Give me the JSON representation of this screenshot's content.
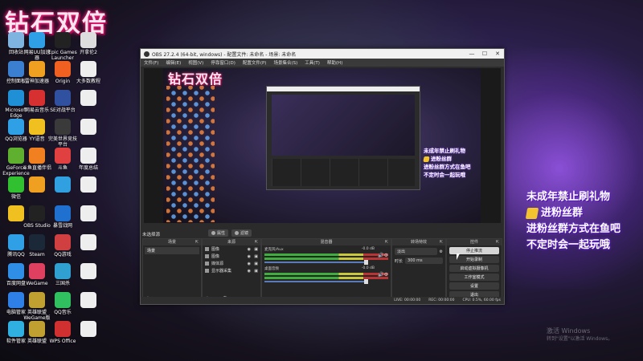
{
  "desktop": {
    "banner": "钻石双倍",
    "icons": [
      {
        "label": "回收站",
        "color": "#7fb3e0"
      },
      {
        "label": "网易UU加速器",
        "color": "#2fa0e6"
      },
      {
        "label": "Epic Games Launcher",
        "color": "#222222"
      },
      {
        "label": "开拿伦2",
        "color": "#dddddd"
      },
      {
        "label": "控制面板",
        "color": "#3a7fd0"
      },
      {
        "label": "雷神加速器",
        "color": "#f0a020"
      },
      {
        "label": "Origin",
        "color": "#f06020"
      },
      {
        "label": "大多数教程",
        "color": "#eeeeee"
      },
      {
        "label": "Microsoft Edge",
        "color": "#1f8fd6"
      },
      {
        "label": "网易云音乐",
        "color": "#d63030"
      },
      {
        "label": "SE对战平台",
        "color": "#3050a0"
      },
      {
        "label": "",
        "color": "#eeeeee"
      },
      {
        "label": "QQ浏览器",
        "color": "#2fa0e6"
      },
      {
        "label": "YY语音",
        "color": "#f0c020"
      },
      {
        "label": "完美世界竞技平台",
        "color": "#3a3a3a"
      },
      {
        "label": "",
        "color": "#eeeeee"
      },
      {
        "label": "GeForce Experience",
        "color": "#60b030"
      },
      {
        "label": "斗鱼直播伴侣",
        "color": "#f08020"
      },
      {
        "label": "斗鱼",
        "color": "#e04040"
      },
      {
        "label": "年度总结",
        "color": "#eeeeee"
      },
      {
        "label": "微信",
        "color": "#30c030"
      },
      {
        "label": "",
        "color": "#f0a020"
      },
      {
        "label": "",
        "color": "#30a0e0"
      },
      {
        "label": "",
        "color": "#eeeeee"
      },
      {
        "label": "",
        "color": "#f0c020"
      },
      {
        "label": "OBS Studio",
        "color": "#222222"
      },
      {
        "label": "暴雪战网",
        "color": "#2070d0"
      },
      {
        "label": "",
        "color": "#eeeeee"
      },
      {
        "label": "腾讯QQ",
        "color": "#2fa0e6"
      },
      {
        "label": "Steam",
        "color": "#1b2838"
      },
      {
        "label": "QQ游戏",
        "color": "#d04040"
      },
      {
        "label": "",
        "color": "#eeeeee"
      },
      {
        "label": "百度网盘",
        "color": "#2f8fe6"
      },
      {
        "label": "WeGame",
        "color": "#e04060"
      },
      {
        "label": "三国杀",
        "color": "#30a0d0"
      },
      {
        "label": "",
        "color": "#eeeeee"
      },
      {
        "label": "电脑管家",
        "color": "#2f80e6"
      },
      {
        "label": "英雄联盟WeGame版",
        "color": "#c0a030"
      },
      {
        "label": "QQ音乐",
        "color": "#30c060"
      },
      {
        "label": "",
        "color": "#eeeeee"
      },
      {
        "label": "软件管家",
        "color": "#30b0e0"
      },
      {
        "label": "英雄联盟",
        "color": "#c0a030"
      },
      {
        "label": "WPS Office",
        "color": "#d03030"
      },
      {
        "label": "",
        "color": "#eeeeee"
      }
    ],
    "right_text": [
      "未成年禁止刷礼物",
      "进粉丝群",
      "进粉丝群方式在鱼吧",
      "不定时会一起玩哦"
    ],
    "watermark": {
      "line1": "激活 Windows",
      "line2": "转到\"设置\"以激活 Windows。"
    }
  },
  "obs": {
    "title": "OBS 27.2.4 (64-bit, windows) - 配置文件: 未命名 - 场景: 未命名",
    "window_controls": {
      "minimize": "—",
      "maximize": "☐",
      "close": "✕"
    },
    "menu": [
      "文件(F)",
      "编辑(E)",
      "视图(V)",
      "停靠窗口(D)",
      "配置文件(P)",
      "场景集合(S)",
      "工具(T)",
      "帮助(H)"
    ],
    "preview": {
      "banner": "钻石双倍",
      "right_text": [
        "未成年禁止刷礼物",
        "进粉丝群",
        "进粉丝群方式在鱼吧",
        "不定时会一起玩哦"
      ]
    },
    "scene_label": "未选择源",
    "toolbar": {
      "properties": "属性",
      "filters": "滤镜"
    },
    "docks": {
      "scenes": {
        "title": "场景",
        "items": [
          "场景"
        ]
      },
      "sources": {
        "title": "来源",
        "items": [
          {
            "label": "图像",
            "icon": "image-icon"
          },
          {
            "label": "图像",
            "icon": "image-icon"
          },
          {
            "label": "媒体源",
            "icon": "media-icon"
          },
          {
            "label": "显示器采集",
            "icon": "monitor-icon"
          }
        ]
      },
      "mixer": {
        "title": "混音器",
        "channels": [
          {
            "name": "麦克风/Aux",
            "db": "-0.0 dB"
          },
          {
            "name": "桌面音频",
            "db": "-0.0 dB"
          }
        ]
      },
      "transitions": {
        "title": "转场特效",
        "type": "淡出",
        "duration_label": "时长",
        "duration": "300 ms"
      },
      "controls": {
        "title": "控件",
        "buttons": [
          "停止推流",
          "开始录制",
          "启动虚拟摄像机",
          "工作室模式",
          "设置",
          "退出"
        ]
      }
    },
    "status": {
      "live": "LIVE: 00:00:00",
      "rec": "REC: 00:00:00",
      "cpu": "CPU: 0.5%, 60.00 fps"
    }
  }
}
